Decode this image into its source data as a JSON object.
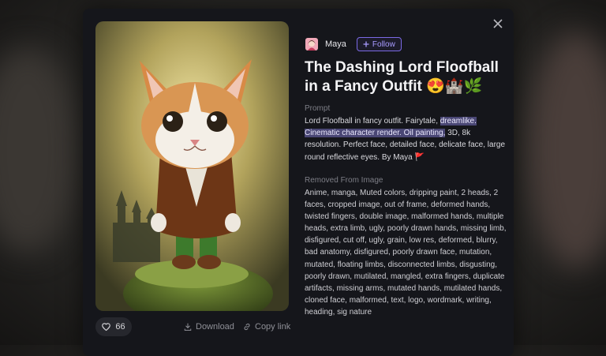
{
  "author": {
    "name": "Maya",
    "follow_label": "Follow"
  },
  "title": "The Dashing Lord Floofball in a Fancy Outfit 😍🏰🌿",
  "prompt": {
    "label": "Prompt",
    "text_before": "Lord Floofball in fancy outfit. Fairytale, ",
    "highlighted": "dreamlike. Cinematic character render. Oil painting,",
    "text_after": " 3D, 8k resolution. Perfect face, detailed face, delicate face, large round reflective eyes. By Maya 🚩"
  },
  "removed": {
    "label": "Removed From Image",
    "text": "Anime, manga, Muted colors, dripping paint, 2 heads, 2 faces, cropped image, out of frame, deformed hands, twisted fingers, double image, malformed hands, multiple heads, extra limb, ugly, poorly drawn hands, missing limb, disfigured, cut off, ugly, grain, low res, deformed, blurry, bad anatomy, disfigured, poorly drawn face, mutation, mutated, floating limbs, disconnected limbs, disgusting, poorly drawn, mutilated, mangled, extra fingers, duplicate artifacts, missing arms, mutated hands, mutilated hands, cloned face, malformed, text, logo, wordmark, writing, heading, sig nature"
  },
  "actions": {
    "likes": "66",
    "download_label": "Download",
    "copy_label": "Copy link"
  },
  "icons": {
    "close": "close-icon",
    "like": "heart-icon",
    "download": "download-icon",
    "copy": "link-icon",
    "follow": "plus-icon"
  },
  "colors": {
    "accent": "#7b6ae6",
    "modal_bg": "#15161b",
    "highlight": "#4a4775"
  }
}
